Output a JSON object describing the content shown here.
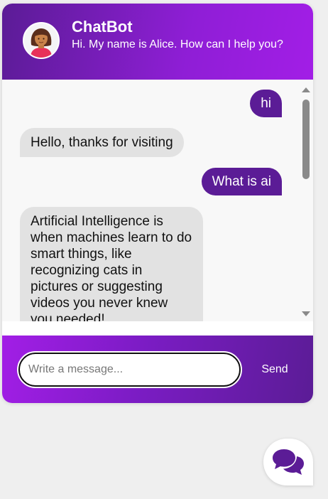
{
  "header": {
    "title": "ChatBot",
    "subtitle": "Hi. My name is Alice. How can I help you?",
    "avatar_icon": "female-user-avatar"
  },
  "messages": [
    {
      "sender": "user",
      "text": "hi"
    },
    {
      "sender": "bot",
      "text": "Hello, thanks for visiting"
    },
    {
      "sender": "user",
      "text": "What is ai"
    },
    {
      "sender": "bot",
      "text": "Artificial Intelligence is when machines learn to do smart things, like recognizing cats in pictures or suggesting videos you never knew you needed!"
    }
  ],
  "composer": {
    "placeholder": "Write a message...",
    "value": "",
    "send_label": "Send"
  },
  "launcher": {
    "icon": "chat-bubbles-icon"
  },
  "colors": {
    "brand_dark": "#5b1c96",
    "brand_light": "#a21ee6",
    "bot_bubble": "#e2e2e2",
    "page_background": "#efefef"
  }
}
